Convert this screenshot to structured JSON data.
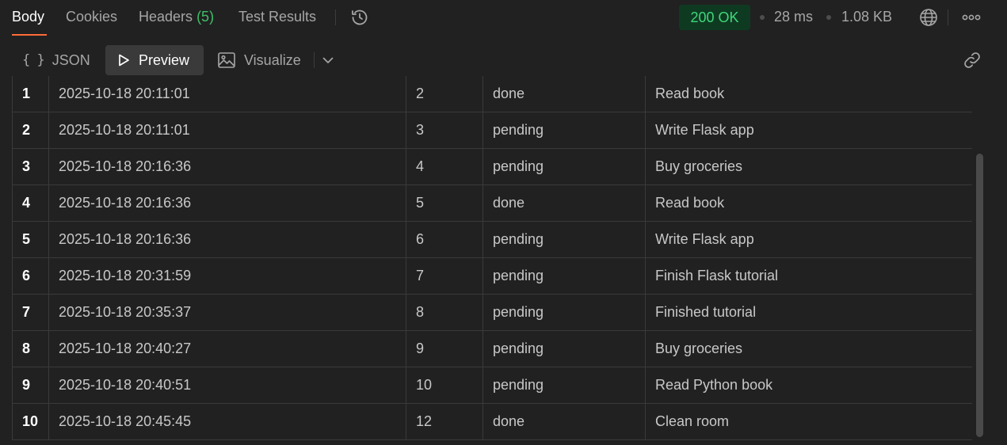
{
  "tabs": [
    {
      "label": "Body",
      "active": true
    },
    {
      "label": "Cookies"
    },
    {
      "label": "Headers",
      "count": "(5)"
    },
    {
      "label": "Test Results"
    }
  ],
  "status": {
    "code": "200 OK",
    "time": "28 ms",
    "size": "1.08 KB"
  },
  "icons": {
    "history": "history-icon",
    "globe": "globe-icon",
    "more": "more-icon",
    "braces": "braces-icon",
    "play": "play-icon",
    "image": "image-icon",
    "chevron": "chevron-down-icon",
    "link": "link-icon"
  },
  "formats": {
    "json": "JSON",
    "preview": "Preview",
    "visualize": "Visualize",
    "json_braces": "{ }"
  },
  "colors": {
    "accent": "#ff6c37",
    "success_text": "#3fd77a",
    "success_bg": "#0f3a22",
    "count": "#3fbf6a"
  },
  "rows": [
    {
      "index": "1",
      "created": "2025-10-18 20:11:01",
      "id": "2",
      "status": "done",
      "title": "Read book"
    },
    {
      "index": "2",
      "created": "2025-10-18 20:11:01",
      "id": "3",
      "status": "pending",
      "title": "Write Flask app"
    },
    {
      "index": "3",
      "created": "2025-10-18 20:16:36",
      "id": "4",
      "status": "pending",
      "title": "Buy groceries"
    },
    {
      "index": "4",
      "created": "2025-10-18 20:16:36",
      "id": "5",
      "status": "done",
      "title": "Read book"
    },
    {
      "index": "5",
      "created": "2025-10-18 20:16:36",
      "id": "6",
      "status": "pending",
      "title": "Write Flask app"
    },
    {
      "index": "6",
      "created": "2025-10-18 20:31:59",
      "id": "7",
      "status": "pending",
      "title": "Finish Flask tutorial"
    },
    {
      "index": "7",
      "created": "2025-10-18 20:35:37",
      "id": "8",
      "status": "pending",
      "title": "Finished tutorial"
    },
    {
      "index": "8",
      "created": "2025-10-18 20:40:27",
      "id": "9",
      "status": "pending",
      "title": "Buy groceries"
    },
    {
      "index": "9",
      "created": "2025-10-18 20:40:51",
      "id": "10",
      "status": "pending",
      "title": "Read Python book"
    },
    {
      "index": "10",
      "created": "2025-10-18 20:45:45",
      "id": "12",
      "status": "done",
      "title": "Clean room"
    }
  ]
}
